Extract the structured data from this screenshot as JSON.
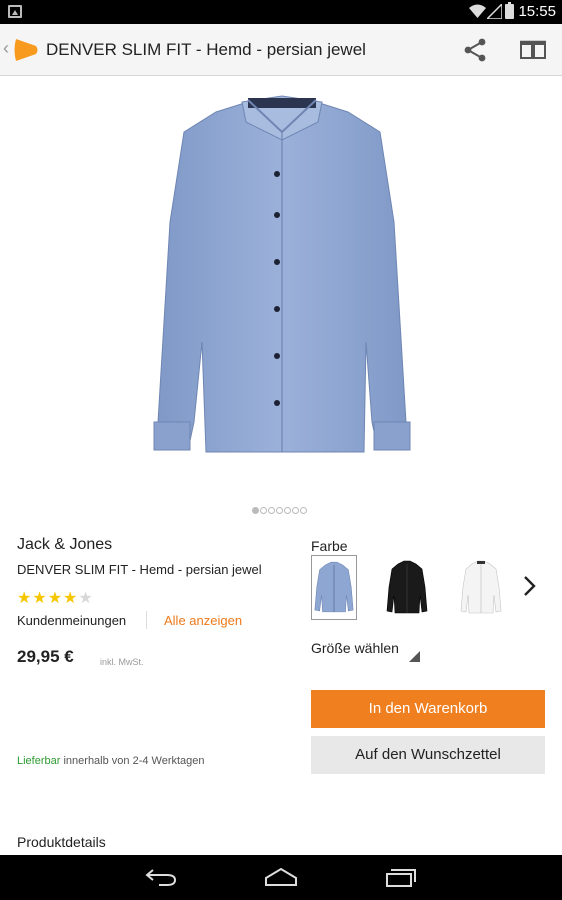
{
  "status": {
    "time": "15:55"
  },
  "appbar": {
    "title": "DENVER SLIM FIT - Hemd - persian jewel"
  },
  "product": {
    "brand": "Jack & Jones",
    "name": "DENVER SLIM FIT - Hemd - persian jewel",
    "rating": 4,
    "rating_max": 5,
    "reviews_label": "Kundenmeinungen",
    "show_all_label": "Alle anzeigen",
    "price": "29,95 €",
    "vat_note": "inkl. MwSt.",
    "availability": "Lieferbar",
    "delivery": " innerhalb von 2-4 Werktagen"
  },
  "gallery": {
    "image_count": 7,
    "active_index": 0
  },
  "variants": {
    "color_label": "Farbe",
    "colors": [
      {
        "name": "blue-shirt",
        "hex": "#8ea6d2",
        "selected": true
      },
      {
        "name": "black-shirt",
        "hex": "#1a1a1a",
        "selected": false
      },
      {
        "name": "white-shirt",
        "hex": "#f4f4f4",
        "selected": false
      }
    ],
    "size_label": "Größe wählen"
  },
  "actions": {
    "cart_label": "In den Warenkorb",
    "wishlist_label": "Auf den Wunschzettel"
  },
  "details": {
    "title": "Produktdetails"
  },
  "colors": {
    "accent": "#f07f20",
    "available": "#2f9a2f"
  }
}
